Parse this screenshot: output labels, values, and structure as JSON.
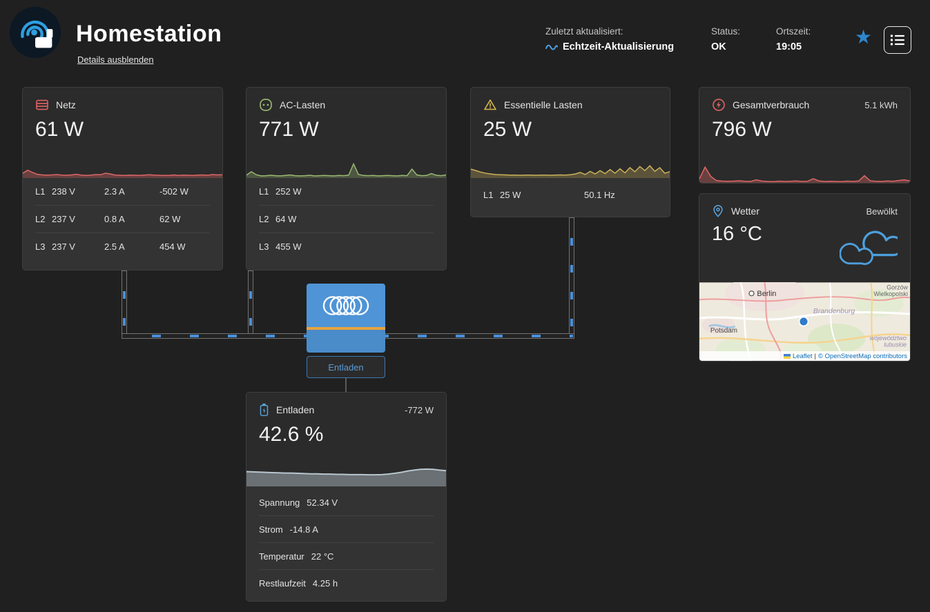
{
  "header": {
    "title": "Homestation",
    "details_link": "Details ausblenden",
    "updated": {
      "label": "Zuletzt aktualisiert:",
      "value": "Echtzeit-Aktualisierung"
    },
    "status": {
      "label": "Status:",
      "value": "OK"
    },
    "local_time": {
      "label": "Ortszeit:",
      "value": "19:05"
    }
  },
  "cards": {
    "grid": {
      "title": "Netz",
      "value": "61 W",
      "rows": [
        {
          "phase": "L1",
          "voltage": "238 V",
          "current": "2.3 A",
          "power": "-502 W"
        },
        {
          "phase": "L2",
          "voltage": "237 V",
          "current": "0.8 A",
          "power": "62 W"
        },
        {
          "phase": "L3",
          "voltage": "237 V",
          "current": "2.5 A",
          "power": "454 W"
        }
      ]
    },
    "ac_loads": {
      "title": "AC-Lasten",
      "value": "771 W",
      "rows": [
        {
          "phase": "L1",
          "power": "252 W"
        },
        {
          "phase": "L2",
          "power": "64 W"
        },
        {
          "phase": "L3",
          "power": "455 W"
        }
      ]
    },
    "essential_loads": {
      "title": "Essentielle Lasten",
      "value": "25 W",
      "row": {
        "phase": "L1",
        "power": "25 W",
        "frequency": "50.1 Hz"
      }
    },
    "total_consumption": {
      "title": "Gesamtverbrauch",
      "energy": "5.1 kWh",
      "value": "796 W"
    },
    "weather": {
      "title": "Wetter",
      "condition": "Bewölkt",
      "value": "16 °C",
      "map": {
        "labels": {
          "city1": "Berlin",
          "city2": "Potsdam",
          "region1": "Brandenburg",
          "region2_line1": "Gorzów",
          "region2_line2": "Wielkopolski",
          "region3_line1": "województwo",
          "region3_line2": "lubuskie"
        },
        "attribution": {
          "leaflet": "Leaflet",
          "separator": "|",
          "copyright": "© OpenStreetMap contributors"
        }
      }
    },
    "inverter": {
      "button": "Entladen"
    },
    "battery": {
      "title": "Entladen",
      "power": "-772 W",
      "value": "42.6 %",
      "rows": [
        {
          "label": "Spannung",
          "value": "52.34 V"
        },
        {
          "label": "Strom",
          "value": "-14.8 A"
        },
        {
          "label": "Temperatur",
          "value": "22 °C"
        },
        {
          "label": "Restlaufzeit",
          "value": "4.25 h"
        }
      ]
    }
  },
  "colors": {
    "accent_blue": "#4a90d9",
    "grid_red": "#de6866",
    "loads_green": "#9ab973",
    "essential_yellow": "#cdb25c",
    "battery_gray": "#b9c6ce"
  },
  "chart_data": [
    {
      "type": "area",
      "name": "grid",
      "title": "Netz Leistung",
      "color": "#de6866",
      "fill_opacity": 0.35,
      "values": [
        22,
        38,
        26,
        16,
        13,
        12,
        13,
        15,
        12,
        11,
        13,
        16,
        12,
        10,
        12,
        15,
        14,
        22,
        18,
        12,
        11,
        10,
        12,
        11,
        10,
        12,
        14,
        12,
        11,
        10,
        10,
        13,
        10,
        12,
        11,
        10,
        12,
        13,
        11,
        15,
        13,
        14
      ]
    },
    {
      "type": "area",
      "name": "ac_loads",
      "title": "AC-Lasten Leistung",
      "color": "#9ab973",
      "fill_opacity": 0.3,
      "values": [
        12,
        30,
        14,
        8,
        9,
        11,
        9,
        8,
        10,
        13,
        9,
        8,
        9,
        11,
        8,
        9,
        10,
        9,
        8,
        10,
        9,
        12,
        72,
        16,
        10,
        9,
        10,
        8,
        9,
        10,
        9,
        8,
        10,
        9,
        44,
        13,
        9,
        10,
        20,
        11,
        9,
        13
      ]
    },
    {
      "type": "area",
      "name": "essential",
      "title": "Essentielle Lasten Leistung",
      "color": "#cdb25c",
      "fill_opacity": 0.3,
      "values": [
        44,
        36,
        28,
        22,
        18,
        15,
        14,
        13,
        12,
        12,
        11,
        12,
        12,
        11,
        12,
        12,
        11,
        12,
        13,
        12,
        14,
        18,
        26,
        15,
        32,
        18,
        36,
        20,
        42,
        22,
        46,
        24,
        52,
        30,
        58,
        36,
        62,
        32,
        52,
        22,
        30
      ]
    },
    {
      "type": "area",
      "name": "total",
      "title": "Gesamtverbrauch Leistung",
      "color": "#de6866",
      "fill_opacity": 0.35,
      "values": [
        25,
        88,
        38,
        16,
        13,
        12,
        13,
        15,
        12,
        11,
        20,
        13,
        11,
        10,
        13,
        11,
        12,
        14,
        11,
        12,
        26,
        14,
        11,
        12,
        11,
        10,
        13,
        11,
        14,
        42,
        15,
        12,
        11,
        14,
        12,
        16,
        20,
        14
      ]
    },
    {
      "type": "area",
      "name": "battery",
      "title": "Batterie Ladezustand",
      "color": "#b9c6ce",
      "fill_opacity": 0.45,
      "stroke_width": 2,
      "values": [
        56,
        55,
        54,
        53,
        52,
        51,
        50,
        50,
        49,
        48,
        47,
        47,
        46,
        46,
        45,
        45,
        44,
        44,
        44,
        43,
        43,
        44,
        46,
        49,
        53,
        58,
        62,
        65,
        66,
        65,
        62,
        60
      ]
    }
  ]
}
